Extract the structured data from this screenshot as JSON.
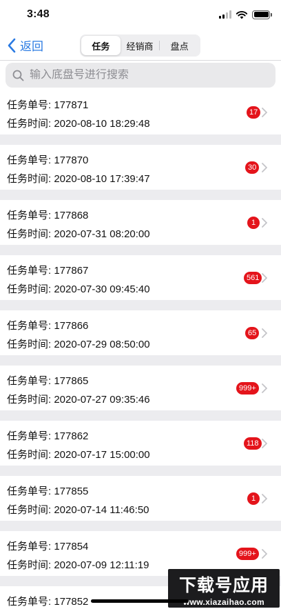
{
  "status_bar": {
    "time": "3:48"
  },
  "nav": {
    "back_label": "返回",
    "tabs": [
      {
        "label": "任务",
        "active": true
      },
      {
        "label": "经销商",
        "active": false
      },
      {
        "label": "盘点",
        "active": false
      }
    ]
  },
  "search": {
    "placeholder": "输入底盘号进行搜索"
  },
  "colors": {
    "accent": "#2a7ae2",
    "badge": "#e4141b"
  },
  "items": [
    {
      "order_label": "任务单号: 177871",
      "time_label": "任务时间: 2020-08-10 18:29:48",
      "badge": "17"
    },
    {
      "order_label": "任务单号: 177870",
      "time_label": "任务时间: 2020-08-10 17:39:47",
      "badge": "30"
    },
    {
      "order_label": "任务单号: 177868",
      "time_label": "任务时间: 2020-07-31 08:20:00",
      "badge": "1"
    },
    {
      "order_label": "任务单号: 177867",
      "time_label": "任务时间: 2020-07-30 09:45:40",
      "badge": "561"
    },
    {
      "order_label": "任务单号: 177866",
      "time_label": "任务时间: 2020-07-29 08:50:00",
      "badge": "65"
    },
    {
      "order_label": "任务单号: 177865",
      "time_label": "任务时间: 2020-07-27 09:35:46",
      "badge": "999+"
    },
    {
      "order_label": "任务单号: 177862",
      "time_label": "任务时间: 2020-07-17 15:00:00",
      "badge": "118"
    },
    {
      "order_label": "任务单号: 177855",
      "time_label": "任务时间: 2020-07-14 11:46:50",
      "badge": "1"
    },
    {
      "order_label": "任务单号: 177854",
      "time_label": "任务时间: 2020-07-09 12:11:19",
      "badge": "999+"
    },
    {
      "order_label": "任务单号: 177852",
      "time_label": "",
      "badge": ""
    }
  ],
  "watermark": {
    "title": "下载号应用",
    "url": "www.xiazaihao.com"
  }
}
